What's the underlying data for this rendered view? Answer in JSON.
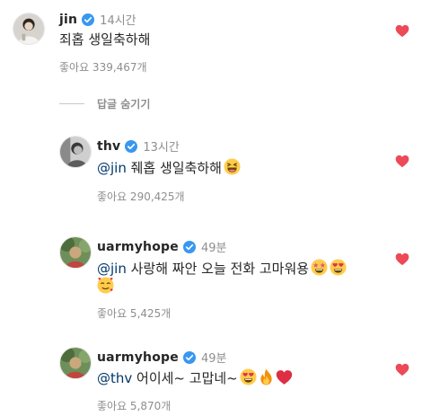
{
  "comments": [
    {
      "username": "jin",
      "time": "14시간",
      "text": "죄홉 생일축하해",
      "likes": "좋아요 339,467개",
      "avatar": "jin-avatar",
      "liked": true
    }
  ],
  "hide_replies_label": "답글 숨기기",
  "replies": [
    {
      "username": "thv",
      "time": "13시간",
      "mention": "@jin",
      "text": " 줴홉 생일축하해",
      "emojis": [
        "laughing-face"
      ],
      "likes": "좋아요 290,425개",
      "avatar": "thv-avatar",
      "liked": true
    },
    {
      "username": "uarmyhope",
      "time": "49분",
      "mention": "@jin",
      "text": " 사랑해 짜안 오늘 전화 고마워용",
      "emojis": [
        "star-struck",
        "heart-eyes",
        "smiling-face-with-hearts"
      ],
      "likes": "좋아요 5,425개",
      "avatar": "uarmyhope-avatar",
      "liked": true
    },
    {
      "username": "uarmyhope",
      "time": "49분",
      "mention": "@thv",
      "text": " 어이세~ 고맙네~",
      "emojis": [
        "heart-eyes",
        "fire",
        "red-heart"
      ],
      "likes": "좋아요 5,870개",
      "avatar": "uarmyhope-avatar",
      "liked": true
    }
  ],
  "colors": {
    "heart": "#ed4956",
    "verified": "#3897f0",
    "mention": "#00376b",
    "meta": "#8e8e8e"
  }
}
